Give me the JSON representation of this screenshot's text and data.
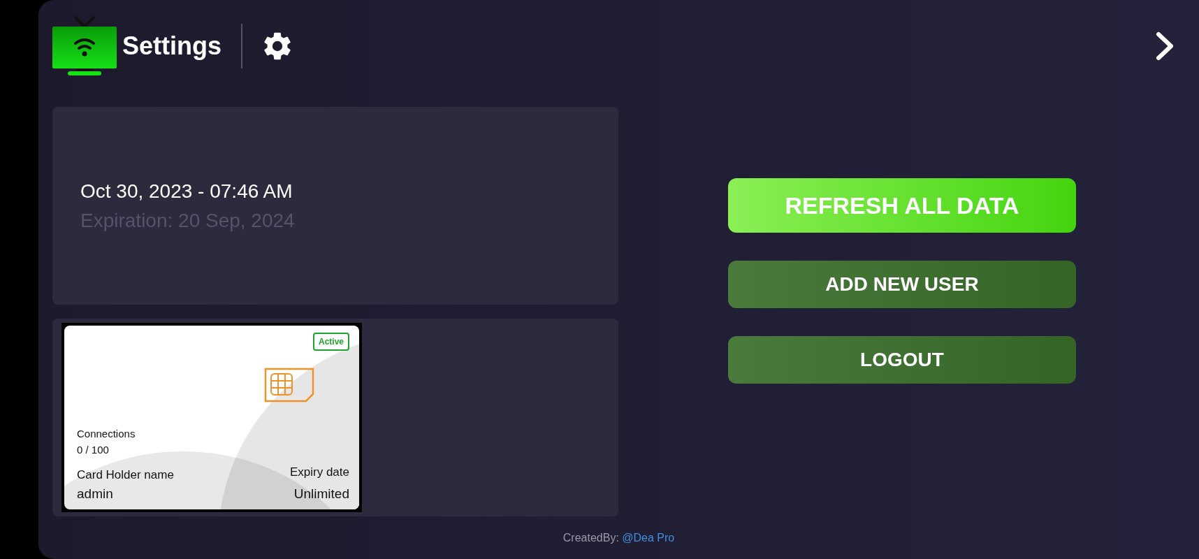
{
  "header": {
    "title": "Settings"
  },
  "info": {
    "datetime": "Oct 30, 2023 - 07:46 AM",
    "expiration": "Expiration: 20 Sep, 2024"
  },
  "card": {
    "status": "Active",
    "active": true,
    "connections_label": "Connections",
    "connections": "0 / 100",
    "holder_label": "Card Holder name",
    "holder": "admin",
    "expiry_label": "Expiry date",
    "expiry": "Unlimited"
  },
  "buttons": [
    {
      "label": "REFRESH ALL DATA",
      "kind": "primary"
    },
    {
      "label": "ADD NEW USER",
      "kind": "secondary"
    },
    {
      "label": "LOGOUT",
      "kind": "secondary"
    }
  ],
  "footer": {
    "prefix": "CreatedBy:",
    "link": "@Dea Pro"
  }
}
